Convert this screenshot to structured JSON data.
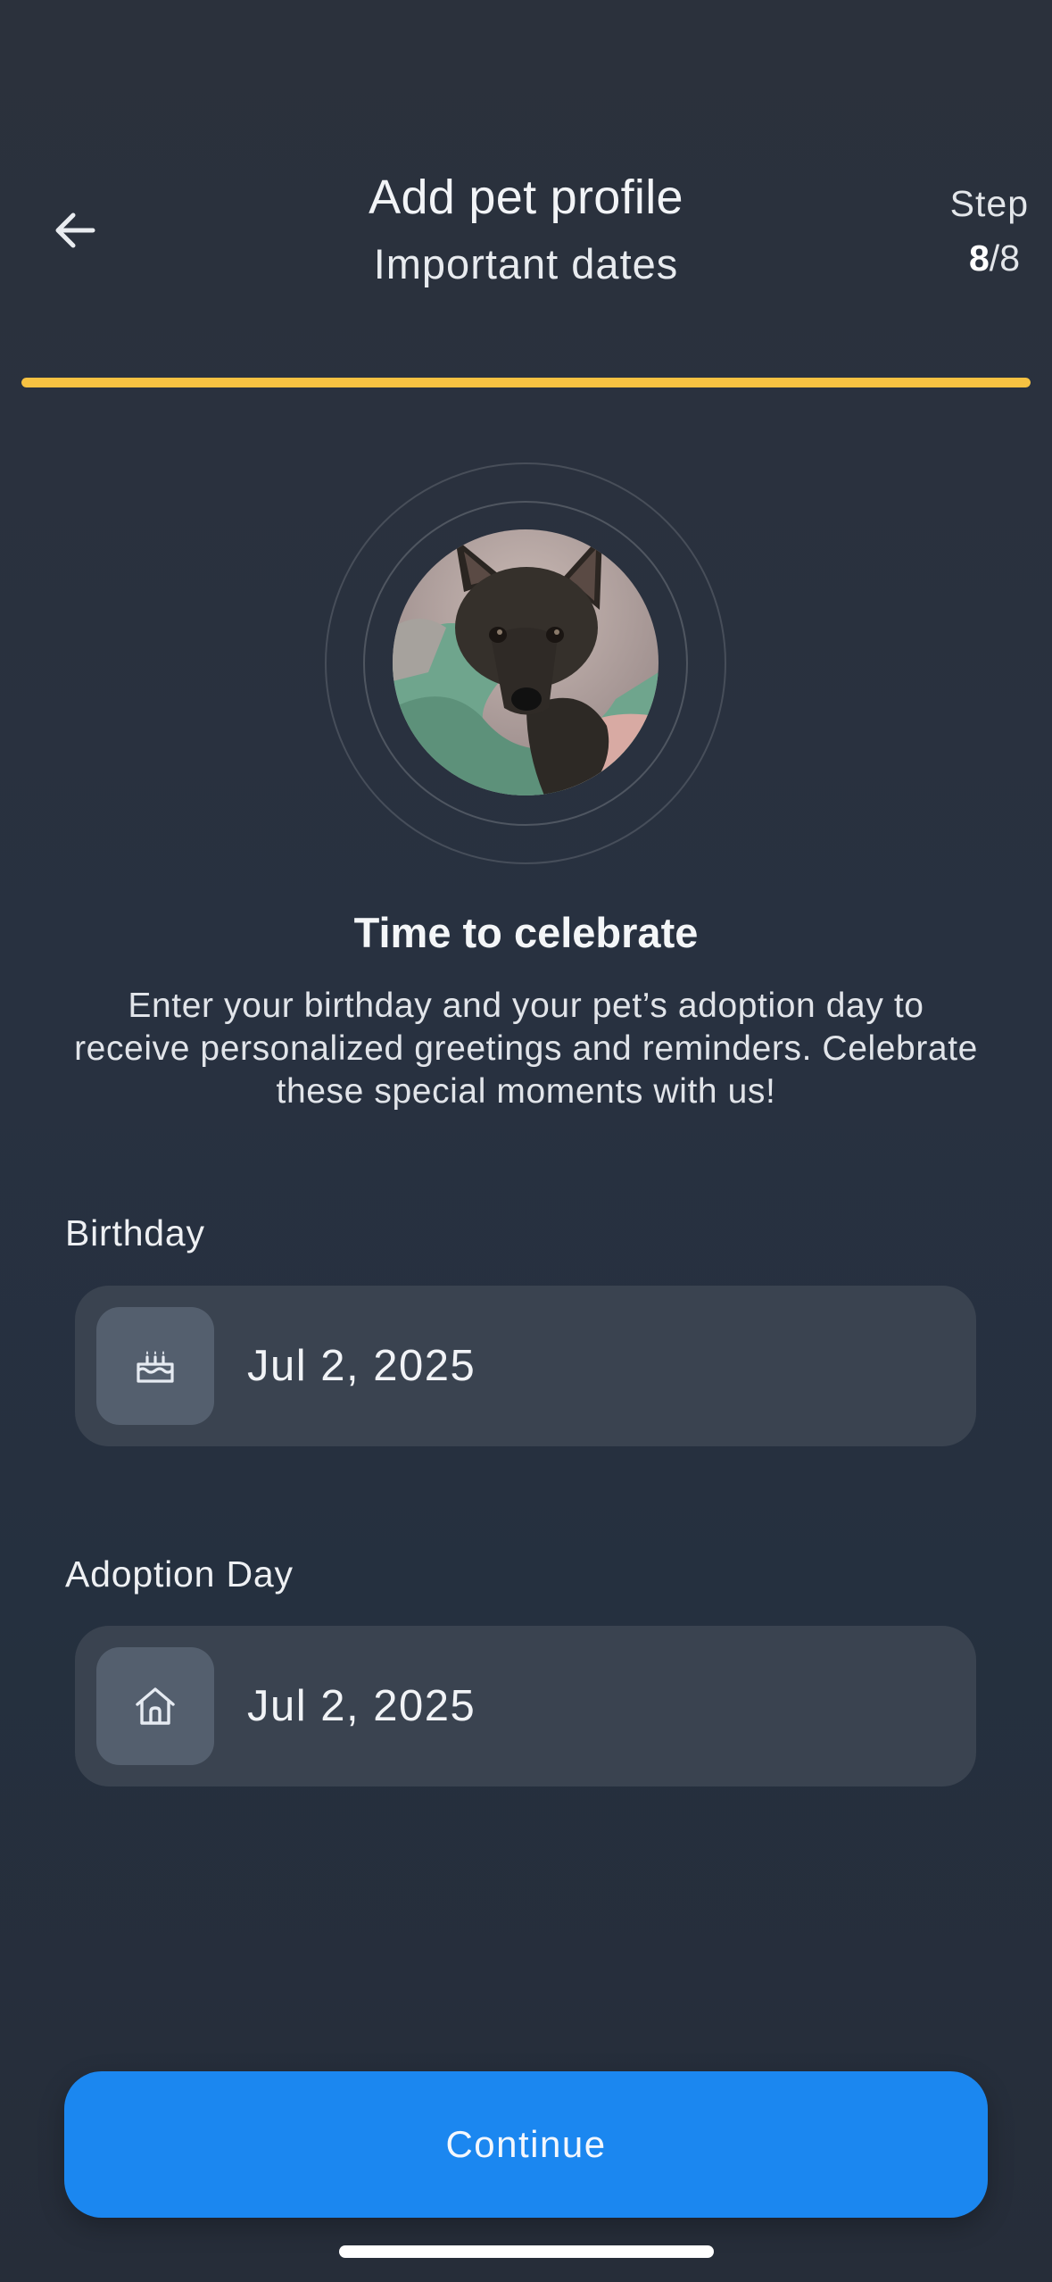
{
  "header": {
    "title": "Add pet profile",
    "subtitle": "Important dates",
    "step_label": "Step",
    "step_current": "8",
    "step_total": "/8",
    "progress": 1.0,
    "progress_color": "#f7c242",
    "back_icon": "arrow-left-icon"
  },
  "intro": {
    "title": "Time to celebrate",
    "description": "Enter your birthday and your pet’s adoption day to receive personalized greetings and reminders. Celebrate these special moments with us!"
  },
  "fields": {
    "birthday": {
      "label": "Birthday",
      "value": "Jul 2, 2025",
      "icon": "cake-icon"
    },
    "adoption": {
      "label": "Adoption Day",
      "value": "Jul 2, 2025",
      "icon": "home-icon"
    }
  },
  "actions": {
    "continue_label": "Continue",
    "continue_color": "#1b87f0"
  }
}
